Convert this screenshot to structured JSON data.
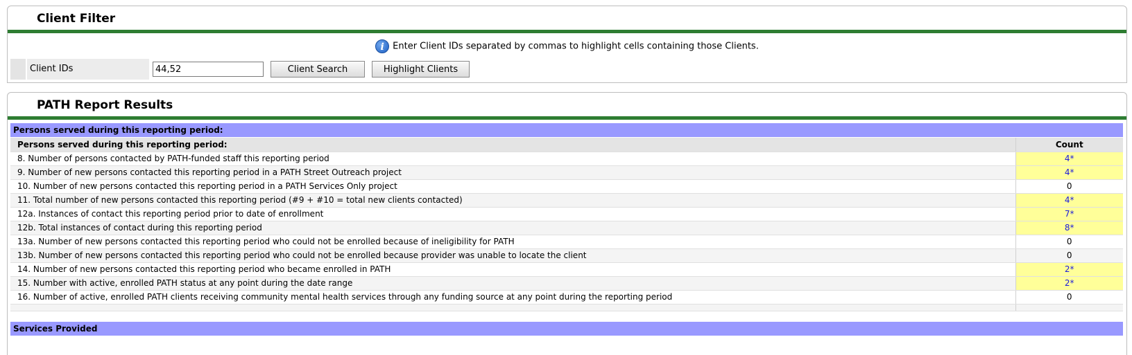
{
  "client_filter": {
    "title": "Client Filter",
    "info_text": "Enter Client IDs separated by commas to highlight cells containing those Clients.",
    "label": "Client IDs",
    "input_value": "44,52",
    "search_button": "Client Search",
    "highlight_button": "Highlight Clients"
  },
  "results": {
    "title": "PATH Report Results",
    "section_title": "Persons served during this reporting period:",
    "table_header": {
      "label": "Persons served during this reporting period:",
      "count": "Count"
    },
    "rows": [
      {
        "label": "8. Number of persons contacted by PATH-funded staff this reporting period",
        "count": "4*"
      },
      {
        "label": "9. Number of new persons contacted this reporting period in a PATH Street Outreach project",
        "count": "4*"
      },
      {
        "label": "10. Number of new persons contacted this reporting period in a PATH Services Only project",
        "count": "0"
      },
      {
        "label": "11. Total number of new persons contacted this reporting period (#9 + #10 = total new clients contacted)",
        "count": "4*"
      },
      {
        "label": "12a. Instances of contact this reporting period prior to date of enrollment",
        "count": "7*"
      },
      {
        "label": "12b. Total instances of contact during this reporting period",
        "count": "8*"
      },
      {
        "label": "13a. Number of new persons contacted this reporting period who could not be enrolled because of ineligibility for PATH",
        "count": "0"
      },
      {
        "label": "13b. Number of new persons contacted this reporting period who could not be enrolled because provider was unable to locate the client",
        "count": "0"
      },
      {
        "label": "14. Number of new persons contacted this reporting period who became enrolled in PATH",
        "count": "2*"
      },
      {
        "label": "15. Number with active, enrolled PATH status at any point during the date range",
        "count": "2*"
      },
      {
        "label": "16. Number of active, enrolled PATH clients receiving community mental health services through any funding source at any point during the reporting period",
        "count": "0"
      }
    ],
    "services_section_title": "Services Provided"
  },
  "colors": {
    "accent_green": "#2e7d32",
    "section_blue": "#9999ff",
    "highlight_yellow": "#ffff99",
    "link_blue": "#1a1adb"
  },
  "icons": {
    "info": "info-icon"
  }
}
